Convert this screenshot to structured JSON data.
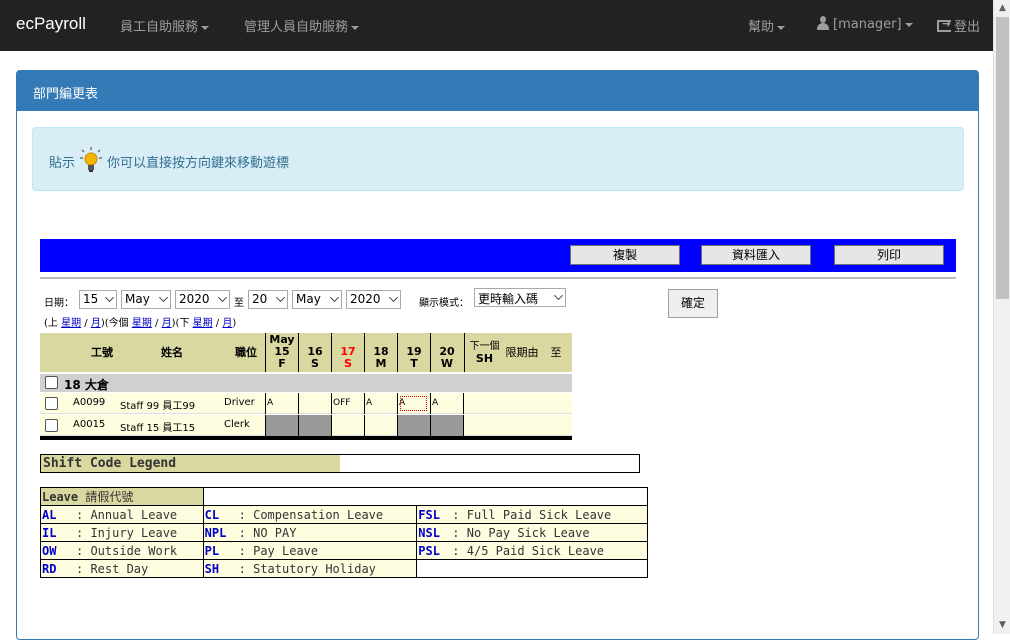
{
  "navbar": {
    "brand": "ecPayroll",
    "menu_employee": "員工自助服務",
    "menu_manager": "管理人員自助服務",
    "help": "幫助",
    "user": "[manager]",
    "logout": "登出"
  },
  "panel": {
    "title": "部門編更表",
    "tip_label": "貼示",
    "tip_text": "你可以直接按方向鍵來移動遊標"
  },
  "toolbar": {
    "copy": "複製",
    "import": "資料匯入",
    "print": "列印"
  },
  "filter": {
    "date_label": "日期：",
    "from_day": "15",
    "from_month": "May",
    "from_year": "2020",
    "to_label": "至",
    "to_day": "20",
    "to_month": "May",
    "to_year": "2020",
    "display_mode_label": "顯示模式：",
    "display_mode": "更時輸入碼",
    "confirm": "確定",
    "nav_prefix": "(上",
    "week": "星期",
    "slash": "/",
    "month": "月",
    "this_prefix": ")(今個",
    "next_prefix": ")(下",
    "close": ")"
  },
  "schedule": {
    "headers": {
      "emp_no": "工號",
      "name": "姓名",
      "position": "職位",
      "month": "May",
      "next": "下一個",
      "sh": "SH",
      "deadline": "限期由",
      "to": "至"
    },
    "days": [
      {
        "num": "15",
        "dow": "F",
        "weekend": false
      },
      {
        "num": "16",
        "dow": "S",
        "weekend": false
      },
      {
        "num": "17",
        "dow": "S",
        "weekend": true
      },
      {
        "num": "18",
        "dow": "M",
        "weekend": false
      },
      {
        "num": "19",
        "dow": "T",
        "weekend": false
      },
      {
        "num": "20",
        "dow": "W",
        "weekend": false
      }
    ],
    "department": "18 大倉",
    "rows": [
      {
        "emp_no": "A0099",
        "name": "Staff 99 員工99",
        "position": "Driver",
        "cells": [
          "A",
          "",
          "OFF",
          "A",
          "A",
          "A"
        ]
      },
      {
        "emp_no": "A0015",
        "name": "Staff 15 員工15",
        "position": "Clerk",
        "cells": [
          "",
          "",
          "",
          "",
          "",
          ""
        ]
      }
    ]
  },
  "legend": {
    "shift_title": "Shift Code Legend",
    "leave_title": "Leave",
    "leave_title_zh": "請假代號",
    "items": [
      {
        "code": "AL",
        "desc": ": Annual Leave"
      },
      {
        "code": "CL",
        "desc": ": Compensation Leave"
      },
      {
        "code": "FSL",
        "desc": ": Full Paid Sick Leave"
      },
      {
        "code": "IL",
        "desc": ": Injury Leave"
      },
      {
        "code": "NPL",
        "desc": ": NO PAY"
      },
      {
        "code": "NSL",
        "desc": ": No Pay Sick Leave"
      },
      {
        "code": "OW",
        "desc": ": Outside Work"
      },
      {
        "code": "PL",
        "desc": ": Pay Leave"
      },
      {
        "code": "PSL",
        "desc": ": 4/5 Paid Sick Leave"
      },
      {
        "code": "RD",
        "desc": ": Rest Day"
      },
      {
        "code": "SH",
        "desc": ": Statutory Holiday"
      }
    ]
  },
  "colors": {
    "navbar": "#222222",
    "panel_heading": "#337ab7",
    "toolbar": "#0000ff",
    "weekend": "#ff0000",
    "code": "#0000cc"
  }
}
